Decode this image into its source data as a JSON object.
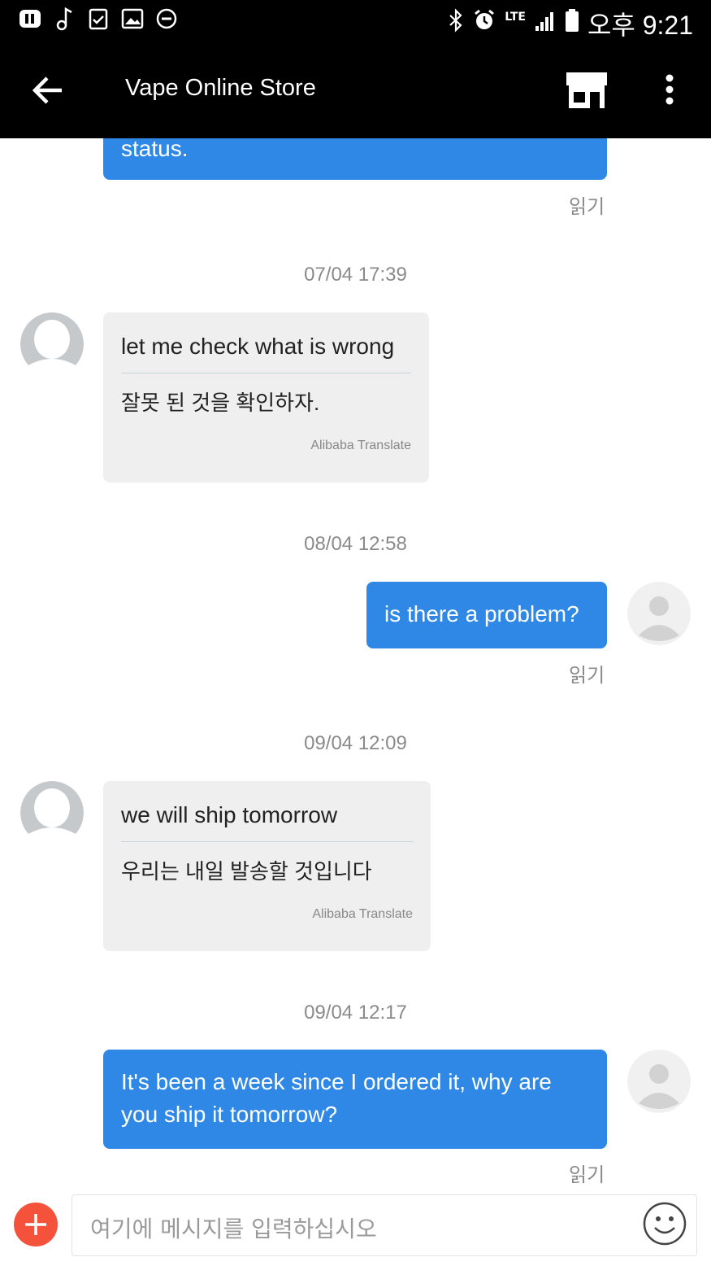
{
  "status_bar": {
    "network": "LTE",
    "time": "오후 9:21"
  },
  "app_bar": {
    "title": "Vape Online Store"
  },
  "messages": [
    {
      "type": "outgoing",
      "text": "status.",
      "read": "읽기"
    },
    {
      "type": "timestamp",
      "text": "07/04 17:39"
    },
    {
      "type": "incoming",
      "original": "let me check what is wrong",
      "translation": "잘못 된 것을 확인하자.",
      "source": "Alibaba Translate"
    },
    {
      "type": "timestamp",
      "text": "08/04 12:58"
    },
    {
      "type": "outgoing",
      "text": "is there a problem?",
      "read": "읽기"
    },
    {
      "type": "timestamp",
      "text": "09/04 12:09"
    },
    {
      "type": "incoming",
      "original": "we will ship tomorrow",
      "translation": "우리는 내일 발송할 것입니다",
      "source": "Alibaba Translate"
    },
    {
      "type": "timestamp",
      "text": "09/04 12:17"
    },
    {
      "type": "outgoing",
      "text_line1": "It's been a week since I ordered it, why are",
      "text_line2": "you ship it tomorrow?",
      "read": "읽기"
    }
  ],
  "input": {
    "placeholder": "여기에 메시지를 입력하십시오"
  },
  "colors": {
    "outgoing_bubble": "#2f88e5",
    "incoming_bubble": "#efefef",
    "add_button": "#f4523a"
  },
  "icons": {
    "back": "arrow-left-icon",
    "store": "store-icon",
    "more": "more-vert-icon",
    "add": "plus-icon",
    "emoji": "smiley-icon"
  }
}
